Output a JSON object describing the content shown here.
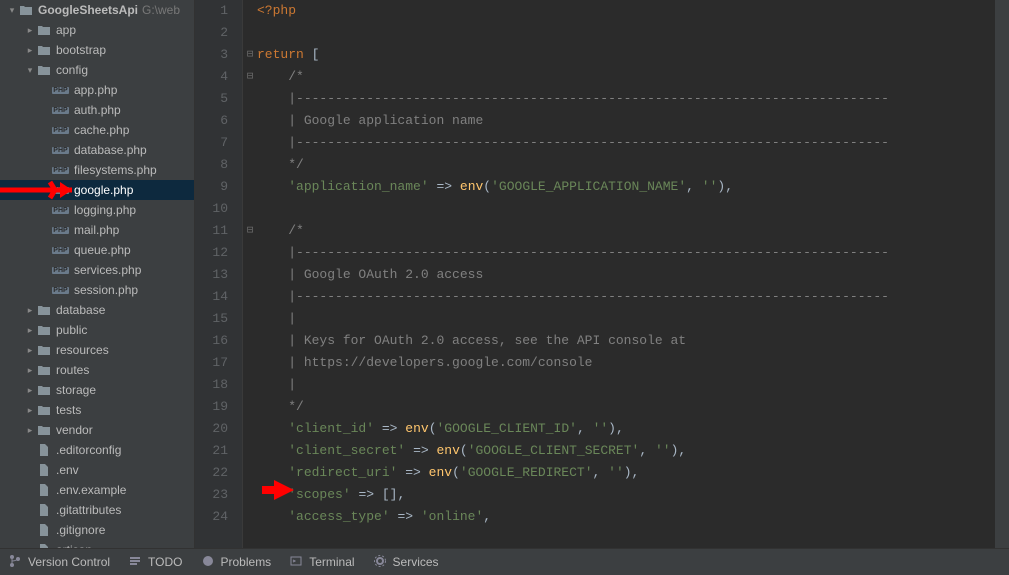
{
  "project": {
    "name": "GoogleSheetsApi",
    "path_suffix": "G:\\web"
  },
  "tree": [
    {
      "indent": 0,
      "expand": "down",
      "kind": "folder",
      "label": "GoogleSheetsApi",
      "suffix": "G:\\web",
      "root": true
    },
    {
      "indent": 1,
      "expand": "right",
      "kind": "folder",
      "label": "app"
    },
    {
      "indent": 1,
      "expand": "right",
      "kind": "folder",
      "label": "bootstrap"
    },
    {
      "indent": 1,
      "expand": "down",
      "kind": "folder",
      "label": "config"
    },
    {
      "indent": 2,
      "expand": "",
      "kind": "php",
      "label": "app.php"
    },
    {
      "indent": 2,
      "expand": "",
      "kind": "php",
      "label": "auth.php"
    },
    {
      "indent": 2,
      "expand": "",
      "kind": "php",
      "label": "cache.php"
    },
    {
      "indent": 2,
      "expand": "",
      "kind": "php",
      "label": "database.php"
    },
    {
      "indent": 2,
      "expand": "",
      "kind": "php",
      "label": "filesystems.php"
    },
    {
      "indent": 2,
      "expand": "",
      "kind": "php",
      "label": "google.php",
      "selected": true
    },
    {
      "indent": 2,
      "expand": "",
      "kind": "php",
      "label": "logging.php"
    },
    {
      "indent": 2,
      "expand": "",
      "kind": "php",
      "label": "mail.php"
    },
    {
      "indent": 2,
      "expand": "",
      "kind": "php",
      "label": "queue.php"
    },
    {
      "indent": 2,
      "expand": "",
      "kind": "php",
      "label": "services.php"
    },
    {
      "indent": 2,
      "expand": "",
      "kind": "php",
      "label": "session.php"
    },
    {
      "indent": 1,
      "expand": "right",
      "kind": "folder",
      "label": "database"
    },
    {
      "indent": 1,
      "expand": "right",
      "kind": "folder",
      "label": "public"
    },
    {
      "indent": 1,
      "expand": "right",
      "kind": "folder",
      "label": "resources"
    },
    {
      "indent": 1,
      "expand": "right",
      "kind": "folder",
      "label": "routes"
    },
    {
      "indent": 1,
      "expand": "right",
      "kind": "folder",
      "label": "storage"
    },
    {
      "indent": 1,
      "expand": "right",
      "kind": "folder",
      "label": "tests"
    },
    {
      "indent": 1,
      "expand": "right",
      "kind": "folder",
      "label": "vendor"
    },
    {
      "indent": 1,
      "expand": "",
      "kind": "file",
      "label": ".editorconfig"
    },
    {
      "indent": 1,
      "expand": "",
      "kind": "file",
      "label": ".env"
    },
    {
      "indent": 1,
      "expand": "",
      "kind": "file",
      "label": ".env.example"
    },
    {
      "indent": 1,
      "expand": "",
      "kind": "file",
      "label": ".gitattributes"
    },
    {
      "indent": 1,
      "expand": "",
      "kind": "file",
      "label": ".gitignore"
    },
    {
      "indent": 1,
      "expand": "",
      "kind": "file",
      "label": "artisan"
    }
  ],
  "code_lines": [
    {
      "n": 1,
      "fold": "",
      "html": "<span class='tok-tag'>&lt;?php</span>"
    },
    {
      "n": 2,
      "fold": "",
      "html": ""
    },
    {
      "n": 3,
      "fold": "–",
      "html": "<span class='tok-keyword'>return</span> <span class='tok-punct'>[</span>"
    },
    {
      "n": 4,
      "fold": "–",
      "html": "    <span class='tok-comment'>/*</span>"
    },
    {
      "n": 5,
      "fold": "",
      "html": "    <span class='tok-comment'>|----------------------------------------------------------------------------</span>"
    },
    {
      "n": 6,
      "fold": "",
      "html": "    <span class='tok-comment'>| Google application name</span>"
    },
    {
      "n": 7,
      "fold": "",
      "html": "    <span class='tok-comment'>|----------------------------------------------------------------------------</span>"
    },
    {
      "n": 8,
      "fold": "",
      "html": "    <span class='tok-comment'>*/</span>"
    },
    {
      "n": 9,
      "fold": "",
      "html": "    <span class='tok-string'>'application_name'</span> <span class='tok-punct'>=&gt;</span> <span class='tok-func'>env</span><span class='tok-punct'>(</span><span class='tok-string'>'GOOGLE_APPLICATION_NAME'</span><span class='tok-punct'>,</span> <span class='tok-string'>''</span><span class='tok-punct'>),</span>"
    },
    {
      "n": 10,
      "fold": "",
      "html": ""
    },
    {
      "n": 11,
      "fold": "–",
      "html": "    <span class='tok-comment'>/*</span>"
    },
    {
      "n": 12,
      "fold": "",
      "html": "    <span class='tok-comment'>|----------------------------------------------------------------------------</span>"
    },
    {
      "n": 13,
      "fold": "",
      "html": "    <span class='tok-comment'>| Google OAuth 2.0 access</span>"
    },
    {
      "n": 14,
      "fold": "",
      "html": "    <span class='tok-comment'>|----------------------------------------------------------------------------</span>"
    },
    {
      "n": 15,
      "fold": "",
      "html": "    <span class='tok-comment'>|</span>"
    },
    {
      "n": 16,
      "fold": "",
      "html": "    <span class='tok-comment'>| Keys for OAuth 2.0 access, see the API console at</span>"
    },
    {
      "n": 17,
      "fold": "",
      "html": "    <span class='tok-comment'>| https://developers.google.com/console</span>"
    },
    {
      "n": 18,
      "fold": "",
      "html": "    <span class='tok-comment'>|</span>"
    },
    {
      "n": 19,
      "fold": "",
      "html": "    <span class='tok-comment'>*/</span>"
    },
    {
      "n": 20,
      "fold": "",
      "html": "    <span class='tok-string'>'client_id'</span> <span class='tok-punct'>=&gt;</span> <span class='tok-func'>env</span><span class='tok-punct'>(</span><span class='tok-string'>'GOOGLE_CLIENT_ID'</span><span class='tok-punct'>,</span> <span class='tok-string'>''</span><span class='tok-punct'>),</span>"
    },
    {
      "n": 21,
      "fold": "",
      "html": "    <span class='tok-string'>'client_secret'</span> <span class='tok-punct'>=&gt;</span> <span class='tok-func'>env</span><span class='tok-punct'>(</span><span class='tok-string'>'GOOGLE_CLIENT_SECRET'</span><span class='tok-punct'>,</span> <span class='tok-string'>''</span><span class='tok-punct'>),</span>"
    },
    {
      "n": 22,
      "fold": "",
      "html": "    <span class='tok-string'>'redirect_uri'</span> <span class='tok-punct'>=&gt;</span> <span class='tok-func'>env</span><span class='tok-punct'>(</span><span class='tok-string'>'GOOGLE_REDIRECT'</span><span class='tok-punct'>,</span> <span class='tok-string'>''</span><span class='tok-punct'>),</span>"
    },
    {
      "n": 23,
      "fold": "",
      "html": "    <span class='tok-string'>'scopes'</span> <span class='tok-punct'>=&gt;</span> <span class='tok-punct'>[],</span>"
    },
    {
      "n": 24,
      "fold": "",
      "html": "    <span class='tok-string'>'access_type'</span> <span class='tok-punct'>=&gt;</span> <span class='tok-string'>'online'</span><span class='tok-punct'>,</span>"
    }
  ],
  "bottom_tabs": [
    {
      "icon": "branch",
      "label": "Version Control"
    },
    {
      "icon": "list",
      "label": "TODO"
    },
    {
      "icon": "warn",
      "label": "Problems"
    },
    {
      "icon": "term",
      "label": "Terminal"
    },
    {
      "icon": "gear",
      "label": "Services"
    }
  ]
}
